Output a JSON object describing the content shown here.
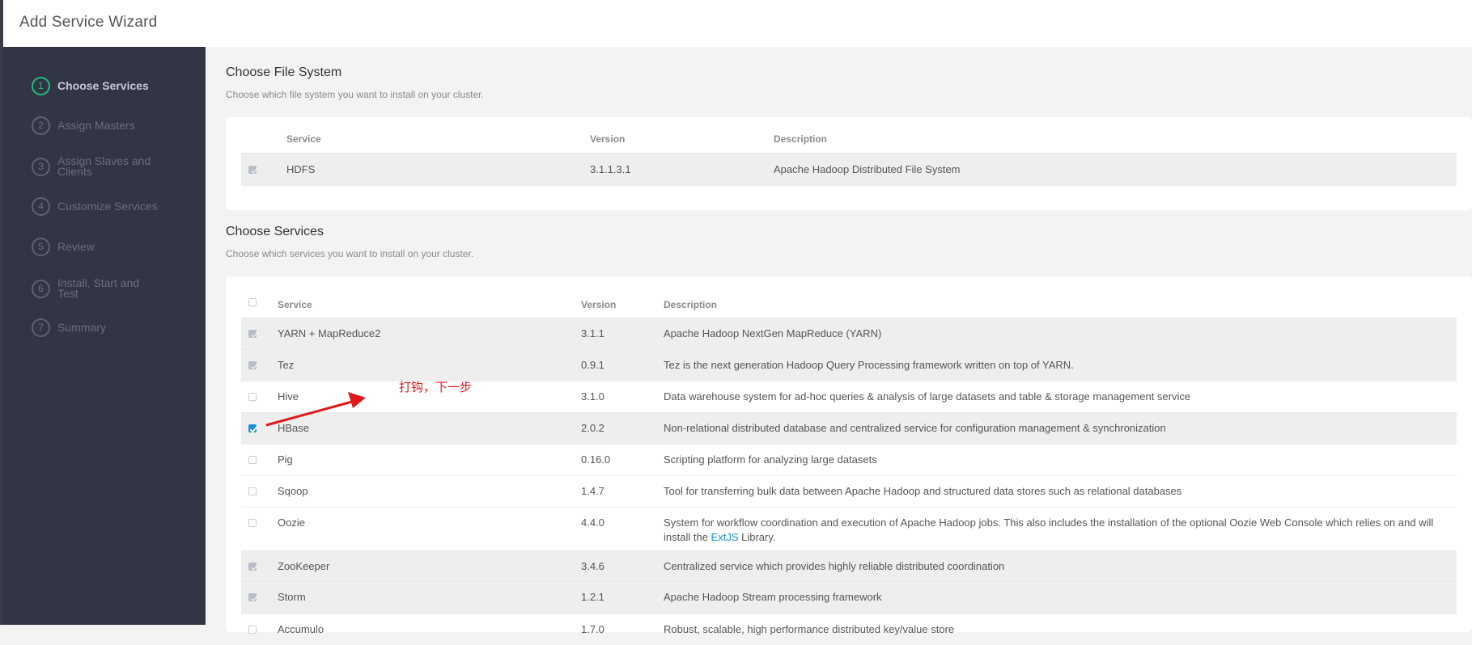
{
  "header": {
    "title": "Add Service Wizard"
  },
  "sidebar": {
    "steps": [
      {
        "number": "1",
        "label": "Choose Services",
        "active": true
      },
      {
        "number": "2",
        "label": "Assign Masters",
        "active": false
      },
      {
        "number": "3",
        "label": "Assign Slaves and Clients",
        "active": false
      },
      {
        "number": "4",
        "label": "Customize Services",
        "active": false
      },
      {
        "number": "5",
        "label": "Review",
        "active": false
      },
      {
        "number": "6",
        "label": "Install, Start and Test",
        "active": false
      },
      {
        "number": "7",
        "label": "Summary",
        "active": false
      }
    ]
  },
  "file_system": {
    "title": "Choose File System",
    "subtitle": "Choose which file system you want to install on your cluster.",
    "columns": {
      "service": "Service",
      "version": "Version",
      "description": "Description"
    },
    "rows": [
      {
        "service": "HDFS",
        "version": "3.1.1.3.1",
        "description": "Apache Hadoop Distributed File System",
        "checked": true,
        "disabled": true
      }
    ]
  },
  "services": {
    "title": "Choose Services",
    "subtitle": "Choose which services you want to install on your cluster.",
    "columns": {
      "service": "Service",
      "version": "Version",
      "description": "Description"
    },
    "select_all_checked": false,
    "rows": [
      {
        "service": "YARN + MapReduce2",
        "version": "3.1.1",
        "description": "Apache Hadoop NextGen MapReduce (YARN)",
        "checked": true,
        "disabled": true
      },
      {
        "service": "Tez",
        "version": "0.9.1",
        "description": "Tez is the next generation Hadoop Query Processing framework written on top of YARN.",
        "checked": true,
        "disabled": true
      },
      {
        "service": "Hive",
        "version": "3.1.0",
        "description": "Data warehouse system for ad-hoc queries & analysis of large datasets and table & storage management service",
        "checked": false,
        "disabled": false
      },
      {
        "service": "HBase",
        "version": "2.0.2",
        "description": "Non-relational distributed database and centralized service for configuration management & synchronization",
        "checked": true,
        "disabled": false
      },
      {
        "service": "Pig",
        "version": "0.16.0",
        "description": "Scripting platform for analyzing large datasets",
        "checked": false,
        "disabled": false
      },
      {
        "service": "Sqoop",
        "version": "1.4.7",
        "description": "Tool for transferring bulk data between Apache Hadoop and structured data stores such as relational databases",
        "checked": false,
        "disabled": false
      },
      {
        "service": "Oozie",
        "version": "4.4.0",
        "description_before_link": "System for workflow coordination and execution of Apache Hadoop jobs. This also includes the installation of the optional Oozie Web Console which relies on and will install the ",
        "description_link": "ExtJS",
        "description_after_link": " Library.",
        "checked": false,
        "disabled": false
      },
      {
        "service": "ZooKeeper",
        "version": "3.4.6",
        "description": "Centralized service which provides highly reliable distributed coordination",
        "checked": true,
        "disabled": true
      },
      {
        "service": "Storm",
        "version": "1.2.1",
        "description": "Apache Hadoop Stream processing framework",
        "checked": true,
        "disabled": true
      },
      {
        "service": "Accumulo",
        "version": "1.7.0",
        "description": "Robust, scalable, high performance distributed key/value store",
        "checked": false,
        "disabled": false
      }
    ]
  },
  "annotation": {
    "text": "打钩，下一步",
    "color": "#e0191c"
  },
  "colors": {
    "sidebar_bg": "#323544",
    "active_step": "#1ebd7c",
    "checkbox_checked": "#1a8fd1",
    "link": "#1a8fd1"
  }
}
